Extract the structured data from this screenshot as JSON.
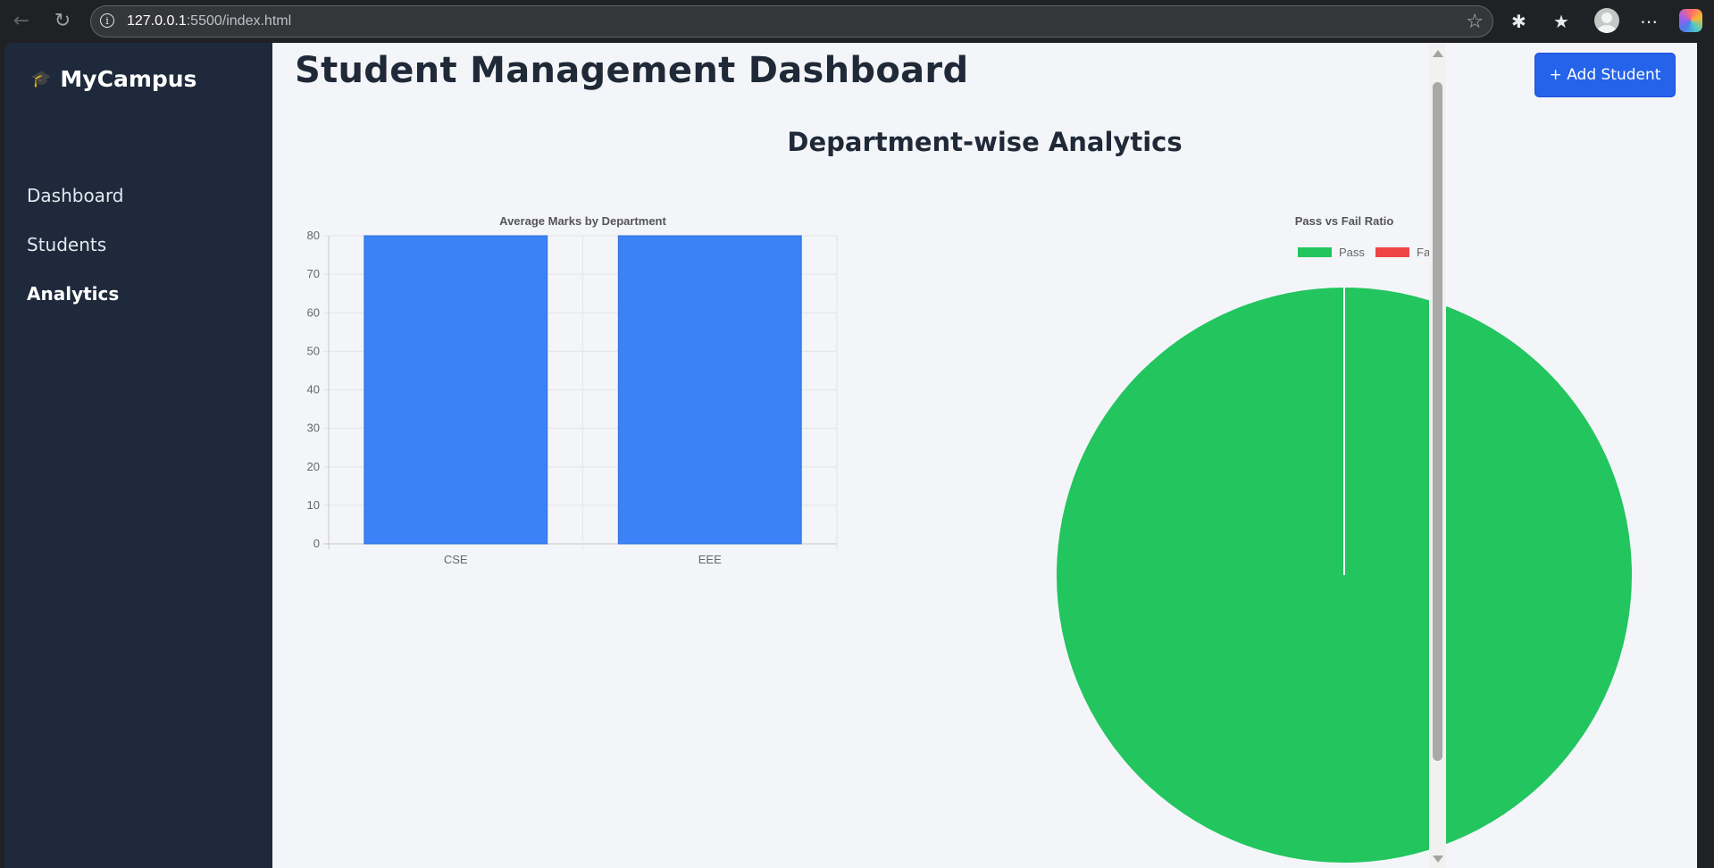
{
  "browser": {
    "url_host": "127.0.0.1",
    "url_rest": ":5500/index.html"
  },
  "sidebar": {
    "brand": "MyCampus",
    "items": [
      {
        "label": "Dashboard",
        "active": false
      },
      {
        "label": "Students",
        "active": false
      },
      {
        "label": "Analytics",
        "active": true
      }
    ]
  },
  "header": {
    "title": "Student Management Dashboard",
    "add_button_label": "+ Add Student"
  },
  "main": {
    "section_title": "Department-wise Analytics"
  },
  "colors": {
    "bar": "#3b82f6",
    "pass": "#22c55e",
    "fail": "#ef4444",
    "sidebar": "#1e293b",
    "primary_button": "#2563eb"
  },
  "chart_data": [
    {
      "type": "bar",
      "title": "Average Marks by Department",
      "categories": [
        "CSE",
        "EEE"
      ],
      "values": [
        80,
        80
      ],
      "ylim": [
        0,
        80
      ],
      "yticks": [
        0,
        10,
        20,
        30,
        40,
        50,
        60,
        70,
        80
      ],
      "grid": true,
      "legend": "none"
    },
    {
      "type": "pie",
      "title": "Pass vs Fail Ratio",
      "labels": [
        "Pass",
        "Fail"
      ],
      "values": [
        1,
        0
      ],
      "legend": "top"
    }
  ]
}
